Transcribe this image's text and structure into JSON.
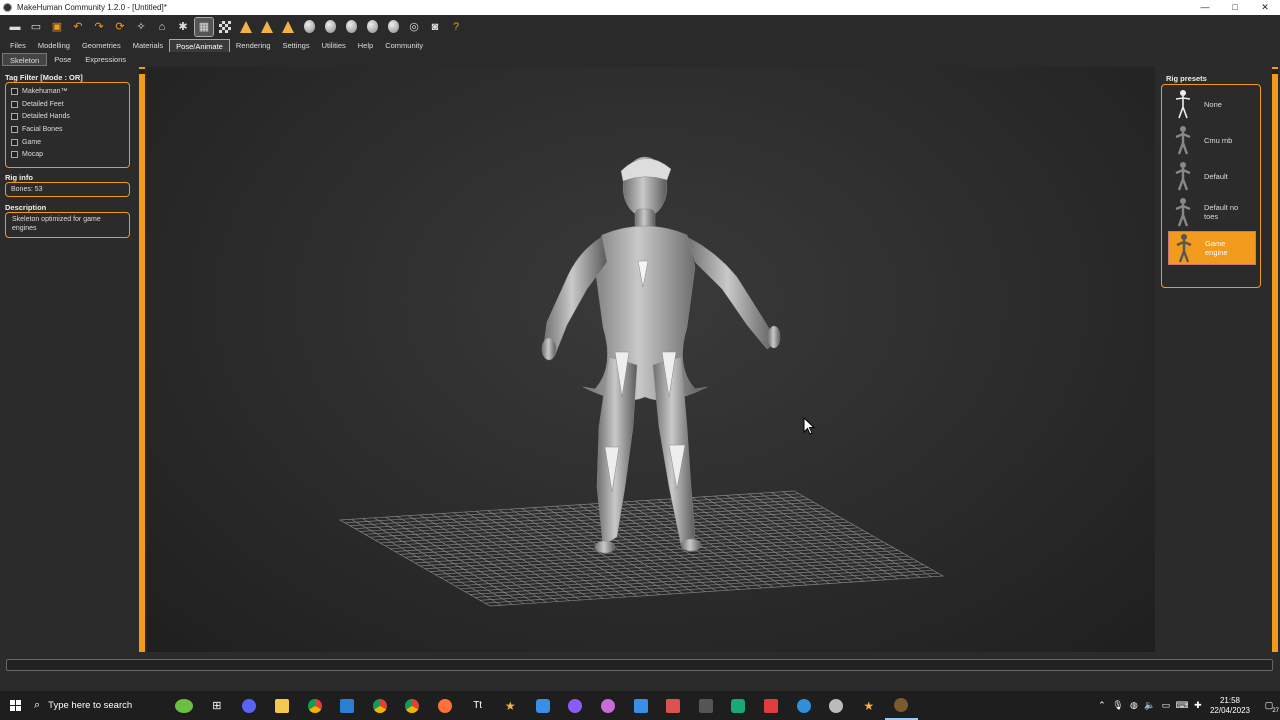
{
  "window": {
    "title": "MakeHuman Community 1.2.0 - [Untitled]*",
    "controls": [
      "—",
      "□",
      "✕"
    ]
  },
  "toolbar": {
    "tools": [
      "new-file",
      "save-file",
      "export-file",
      "undo",
      "redo",
      "reset",
      "smooth",
      "wireframe",
      "pose",
      "grid",
      "checker",
      "front-view",
      "side-view",
      "top-view",
      "head",
      "body",
      "hair",
      "skin",
      "material",
      "pose2",
      "screenshot",
      "help"
    ]
  },
  "menu": {
    "tabs": [
      "Files",
      "Modelling",
      "Geometries",
      "Materials",
      "Pose/Animate",
      "Rendering",
      "Settings",
      "Utilities",
      "Help",
      "Community"
    ],
    "active": "Pose/Animate"
  },
  "subtabs": {
    "tabs": [
      "Skeleton",
      "Pose",
      "Expressions"
    ],
    "active": "Skeleton"
  },
  "tag_filter": {
    "title": "Tag Filter [Mode : OR]",
    "items": [
      "Makehuman™",
      "Detailed Feet",
      "Detailed Hands",
      "Facial Bones",
      "Game",
      "Mocap"
    ]
  },
  "rig_info": {
    "title": "Rig info",
    "bones": "Bones: 53"
  },
  "description": {
    "title": "Description",
    "text": "Skeleton optimized for game engines"
  },
  "rig_presets": {
    "title": "Rig presets",
    "items": [
      {
        "label": "None",
        "selected": false
      },
      {
        "label": "Cmu mb",
        "selected": false
      },
      {
        "label": "Default",
        "selected": false
      },
      {
        "label": "Default no toes",
        "selected": false
      },
      {
        "label": "Game engine",
        "selected": true
      }
    ]
  },
  "taskbar": {
    "search_placeholder": "Type here to search",
    "time": "21:58",
    "date": "22/04/2023",
    "notification_count": "27"
  },
  "colors": {
    "accent": "#f29a1b"
  }
}
